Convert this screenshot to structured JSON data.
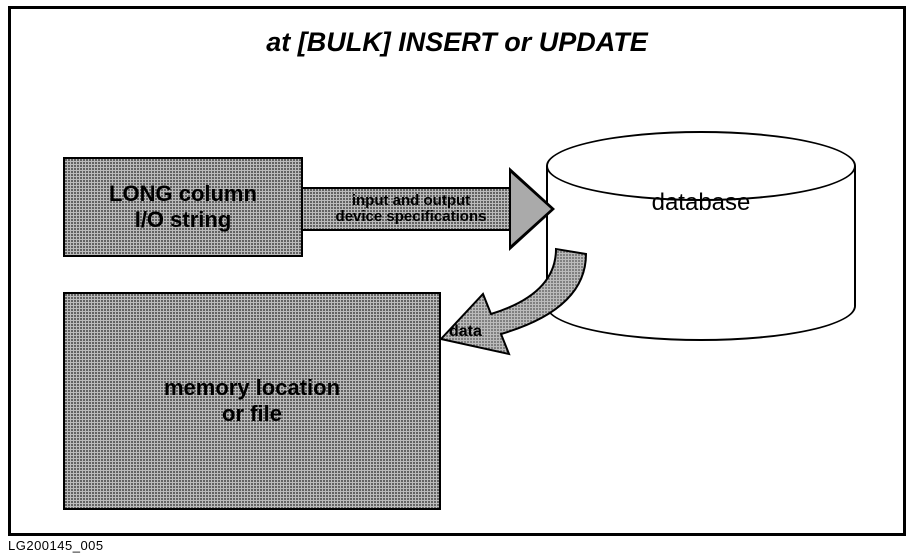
{
  "title": "at [BULK] INSERT or UPDATE",
  "boxes": {
    "long_col": "LONG column\nI/O string",
    "memory": "memory location\nor file"
  },
  "arrows": {
    "spec": "input and output\ndevice specifications",
    "data": "data"
  },
  "db_label": "database",
  "figure_id": "LG200145_005"
}
